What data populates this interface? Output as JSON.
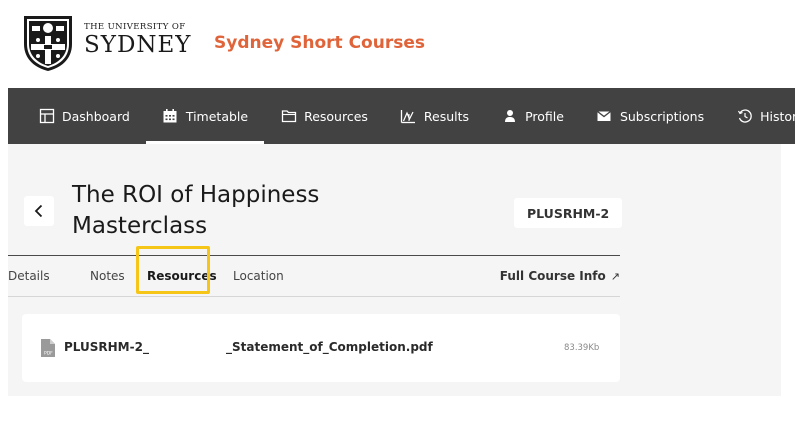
{
  "header": {
    "university_small": "THE UNIVERSITY OF",
    "university_big": "SYDNEY",
    "brand": "Sydney Short Courses"
  },
  "nav": {
    "items": [
      {
        "label": "Dashboard",
        "icon": "dashboard-icon"
      },
      {
        "label": "Timetable",
        "icon": "calendar-icon",
        "active": true
      },
      {
        "label": "Resources",
        "icon": "folder-icon"
      },
      {
        "label": "Results",
        "icon": "chart-icon"
      },
      {
        "label": "Profile",
        "icon": "person-icon"
      },
      {
        "label": "Subscriptions",
        "icon": "envelope-icon"
      },
      {
        "label": "History",
        "icon": "history-icon"
      }
    ]
  },
  "course": {
    "title_line1": "The ROI of Happiness",
    "title_line2": "Masterclass",
    "code": "PLUSRHM-2"
  },
  "tabs": [
    {
      "label": "Details"
    },
    {
      "label": "Notes"
    },
    {
      "label": "Resources",
      "active": true
    },
    {
      "label": "Location"
    }
  ],
  "full_course_info": "Full Course Info",
  "resources": [
    {
      "name_part1": "PLUSRHM-2_",
      "name_part2": "_Statement_of_Completion.pdf",
      "size": "83.39Kb",
      "icon": "pdf-icon"
    }
  ],
  "colors": {
    "brand": "#e0643a",
    "nav_bg": "#424242",
    "highlight": "#f5c518",
    "panel_bg": "#f5f5f5"
  }
}
